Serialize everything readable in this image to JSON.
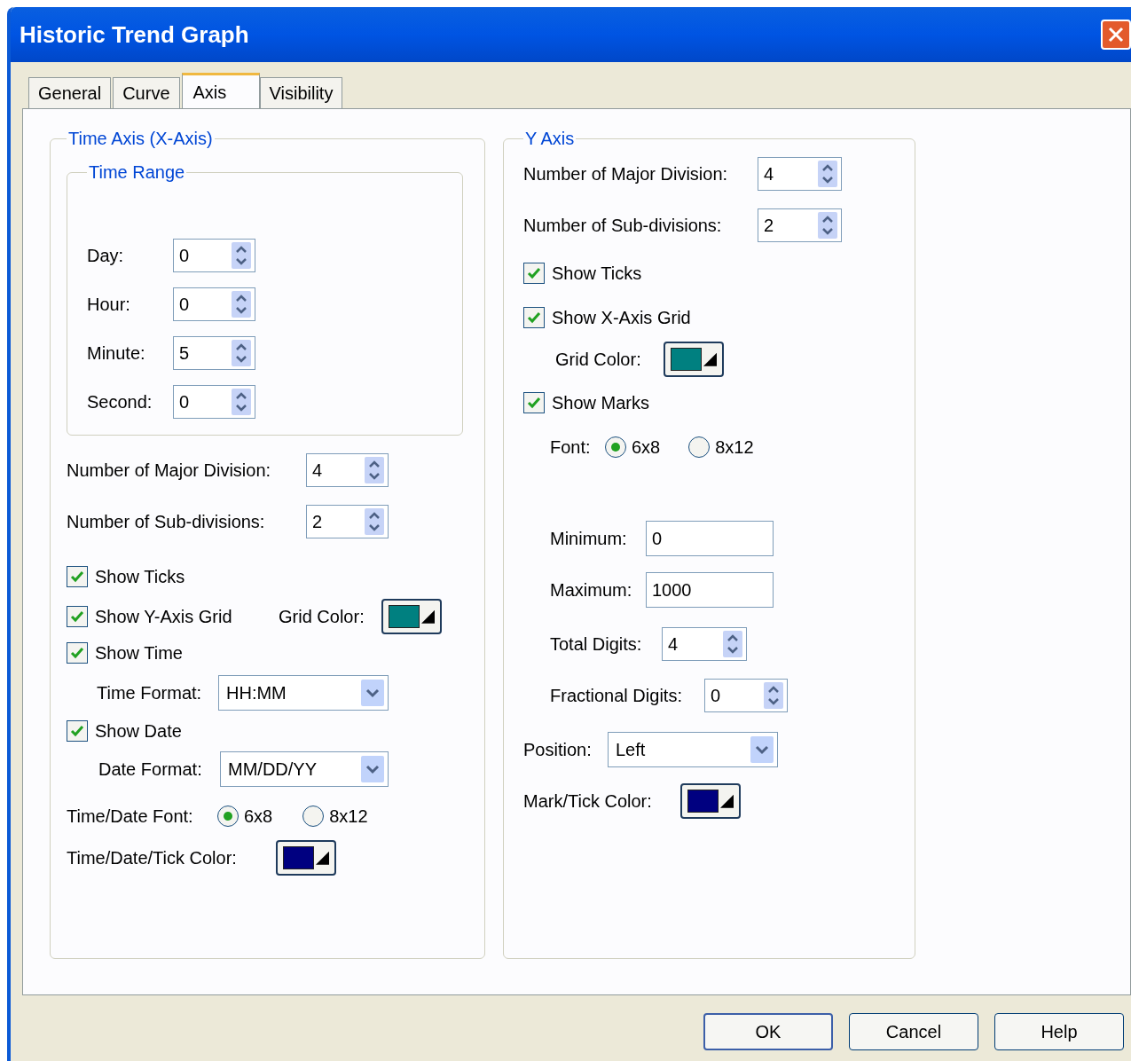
{
  "window": {
    "title": "Historic Trend Graph"
  },
  "tabs": [
    {
      "label": "General",
      "selected": false
    },
    {
      "label": "Curve",
      "selected": false
    },
    {
      "label": "Axis",
      "selected": true
    },
    {
      "label": "Visibility",
      "selected": false
    }
  ],
  "time_axis": {
    "title": "Time Axis (X-Axis)",
    "time_range": {
      "title": "Time Range",
      "fields": [
        {
          "label": "Day:",
          "value": "0"
        },
        {
          "label": "Hour:",
          "value": "0"
        },
        {
          "label": "Minute:",
          "value": "5"
        },
        {
          "label": "Second:",
          "value": "0"
        }
      ]
    },
    "major_division": {
      "label": "Number of Major Division:",
      "value": "4"
    },
    "sub_divisions": {
      "label": "Number of Sub-divisions:",
      "value": "2"
    },
    "show_ticks": {
      "label": "Show Ticks",
      "checked": true
    },
    "show_grid": {
      "label": "Show Y-Axis Grid",
      "checked": true
    },
    "grid_color": {
      "label": "Grid Color:",
      "color": "#008080"
    },
    "show_time": {
      "label": "Show Time",
      "checked": true
    },
    "time_format": {
      "label": "Time Format:",
      "value": "HH:MM"
    },
    "show_date": {
      "label": "Show Date",
      "checked": true
    },
    "date_format": {
      "label": "Date Format:",
      "value": "MM/DD/YY"
    },
    "font": {
      "label": "Time/Date Font:",
      "options": [
        {
          "label": "6x8",
          "selected": true
        },
        {
          "label": "8x12",
          "selected": false
        }
      ]
    },
    "tick_color": {
      "label": "Time/Date/Tick Color:",
      "color": "#000080"
    }
  },
  "y_axis": {
    "title": "Y Axis",
    "major_division": {
      "label": "Number of Major Division:",
      "value": "4"
    },
    "sub_divisions": {
      "label": "Number of Sub-divisions:",
      "value": "2"
    },
    "show_ticks": {
      "label": "Show Ticks",
      "checked": true
    },
    "show_grid": {
      "label": "Show X-Axis Grid",
      "checked": true
    },
    "grid_color": {
      "label": "Grid Color:",
      "color": "#008080"
    },
    "show_marks": {
      "label": "Show Marks",
      "checked": true
    },
    "font": {
      "label": "Font:",
      "options": [
        {
          "label": "6x8",
          "selected": true
        },
        {
          "label": "8x12",
          "selected": false
        }
      ]
    },
    "minimum": {
      "label": "Minimum:",
      "value": "0"
    },
    "maximum": {
      "label": "Maximum:",
      "value": "1000"
    },
    "total_digits": {
      "label": "Total Digits:",
      "value": "4"
    },
    "fractional_digits": {
      "label": "Fractional Digits:",
      "value": "0"
    },
    "position": {
      "label": "Position:",
      "value": "Left"
    },
    "mark_tick_color": {
      "label": "Mark/Tick Color:",
      "color": "#000080"
    }
  },
  "buttons": [
    {
      "label": "OK",
      "default": true
    },
    {
      "label": "Cancel",
      "default": false
    },
    {
      "label": "Help",
      "default": false
    }
  ]
}
